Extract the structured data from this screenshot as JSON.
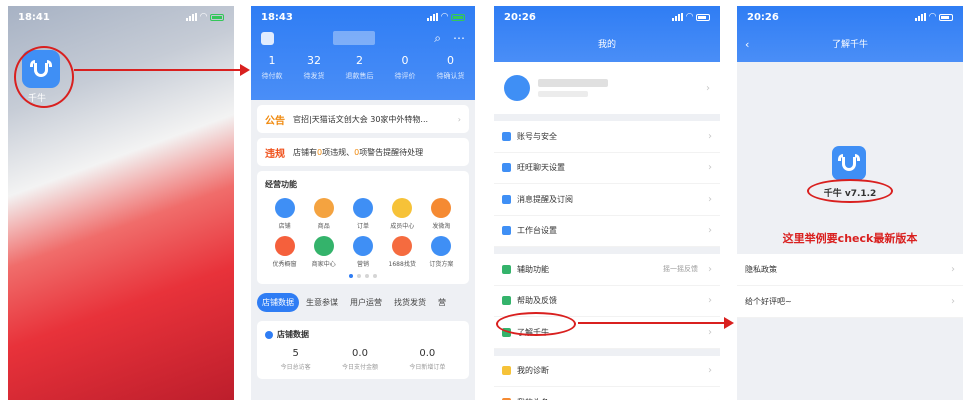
{
  "phone1": {
    "time": "18:41",
    "app_label": "千牛"
  },
  "phone2": {
    "time": "18:43",
    "stats": [
      {
        "num": "1",
        "label": "待付款"
      },
      {
        "num": "32",
        "label": "待发货"
      },
      {
        "num": "2",
        "label": "退款售后"
      },
      {
        "num": "0",
        "label": "待评价"
      },
      {
        "num": "0",
        "label": "待确认货"
      }
    ],
    "notice_tag": "公告",
    "notice_text": "官招|天猫话文创大会 30家中外特物...",
    "violation_tag": "违规",
    "violation_text_a": "店铺有",
    "violation_num_a": "0",
    "violation_text_b": "项违规、",
    "violation_num_b": "0",
    "violation_text_c": "项警告提醒待处理",
    "funcs_title": "经营功能",
    "funcs": [
      {
        "label": "店铺",
        "color": "#3f8ff5"
      },
      {
        "label": "商品",
        "color": "#f4a340"
      },
      {
        "label": "订单",
        "color": "#3f8ff5"
      },
      {
        "label": "成员中心",
        "color": "#f6c238"
      },
      {
        "label": "发微淘",
        "color": "#f58a32"
      },
      {
        "label": "优秀橱窗",
        "color": "#f5603c"
      },
      {
        "label": "商家中心",
        "color": "#34b36b"
      },
      {
        "label": "营销",
        "color": "#3f8ff5"
      },
      {
        "label": "1688找货",
        "color": "#f56b3f"
      },
      {
        "label": "订货方案",
        "color": "#3f8ff5"
      }
    ],
    "tabs": [
      "店铺数据",
      "生意参谋",
      "用户运营",
      "找货发货",
      "营"
    ],
    "shop_data_title": "店铺数据",
    "shop_data": [
      {
        "value": "5",
        "label": "今日总访客"
      },
      {
        "value": "0.0",
        "label": "今日支付金额"
      },
      {
        "value": "0.0",
        "label": "今日新增订单"
      }
    ]
  },
  "phone3": {
    "time": "20:26",
    "title": "我的",
    "group1": [
      {
        "label": "账号与安全",
        "color": "#3f8ff5"
      },
      {
        "label": "旺旺聊天设置",
        "color": "#3f8ff5"
      },
      {
        "label": "消息提醒及订阅",
        "color": "#3f8ff5"
      },
      {
        "label": "工作台设置",
        "color": "#3f8ff5"
      }
    ],
    "group2": [
      {
        "label": "辅助功能",
        "color": "#34b36b",
        "extra": "摇一摇反馈"
      },
      {
        "label": "帮助及反馈",
        "color": "#34b36b",
        "extra": ""
      },
      {
        "label": "了解千牛",
        "color": "#34b36b",
        "extra": ""
      }
    ],
    "group3": [
      {
        "label": "我的诊断",
        "color": "#f6c238"
      },
      {
        "label": "我的头条",
        "color": "#f58a32"
      }
    ]
  },
  "phone4": {
    "time": "20:26",
    "title": "了解千牛",
    "version": "千牛 v7.1.2",
    "note": "这里举例要check最新版本",
    "items": [
      "隐私政策",
      "给个好评吧~"
    ]
  }
}
